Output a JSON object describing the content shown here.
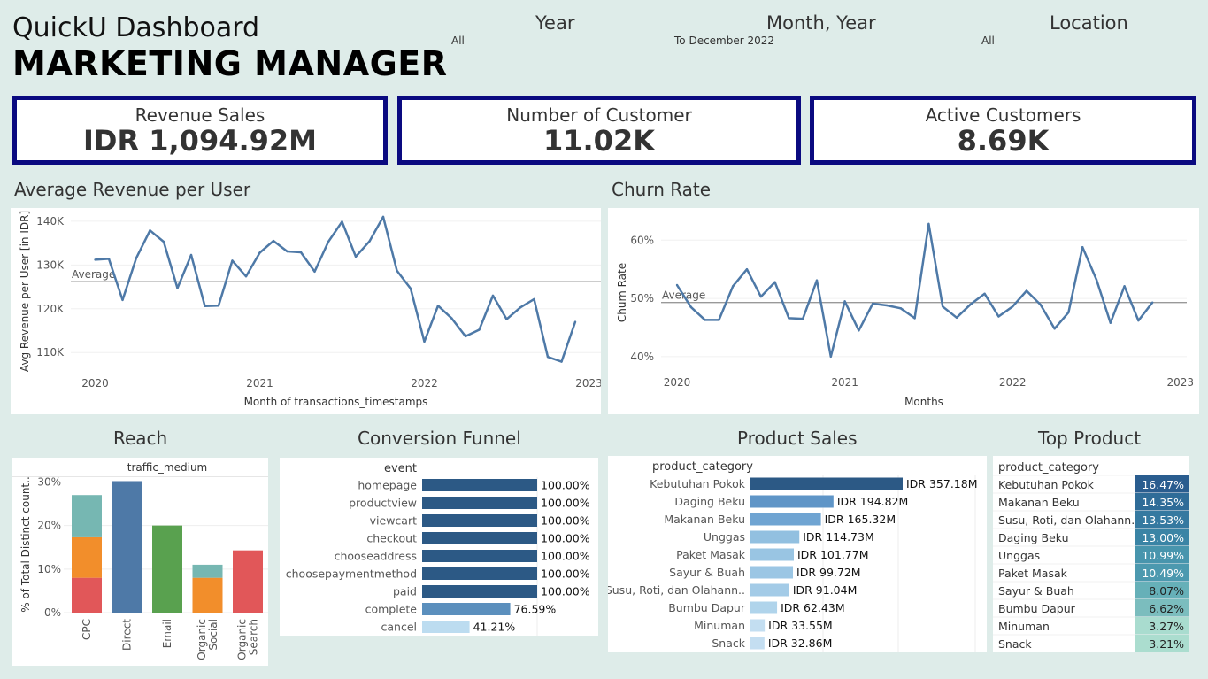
{
  "header": {
    "title": "QuickU Dashboard",
    "subtitle": "MARKETING MANAGER"
  },
  "filters": [
    {
      "label": "Year",
      "value": "All"
    },
    {
      "label": "Month, Year",
      "value": "To December 2022"
    },
    {
      "label": "Location",
      "value": "All"
    }
  ],
  "kpis": [
    {
      "label": "Revenue Sales",
      "value": "IDR 1,094.92M"
    },
    {
      "label": "Number of Customer",
      "value": "11.02K"
    },
    {
      "label": "Active Customers",
      "value": "8.69K"
    }
  ],
  "colors": {
    "line": "#4e79a7",
    "kpi_border": "#0a0a80",
    "background": "#deece9"
  },
  "chart_data": [
    {
      "id": "arpu",
      "type": "line",
      "title": "Average Revenue per User",
      "xlabel": "Month of transactions_timestamps",
      "ylabel": "Avg Revenue per User [in IDR]",
      "x_ticks": [
        "2020",
        "2021",
        "2022",
        "2023"
      ],
      "y_ticks": [
        "110K",
        "120K",
        "130K",
        "140K"
      ],
      "ylim": [
        106,
        142
      ],
      "average_label": "Average",
      "average": 126.2,
      "x": [
        "2020-01",
        "2020-02",
        "2020-03",
        "2020-04",
        "2020-05",
        "2020-06",
        "2020-07",
        "2020-08",
        "2020-09",
        "2020-10",
        "2020-11",
        "2020-12",
        "2021-01",
        "2021-02",
        "2021-03",
        "2021-04",
        "2021-05",
        "2021-06",
        "2021-07",
        "2021-08",
        "2021-09",
        "2021-10",
        "2021-11",
        "2021-12",
        "2022-01",
        "2022-02",
        "2022-03",
        "2022-04",
        "2022-05",
        "2022-06",
        "2022-07",
        "2022-08",
        "2022-09",
        "2022-10",
        "2022-11",
        "2022-12"
      ],
      "values": [
        131.2,
        131.4,
        122,
        131.6,
        137.9,
        135.3,
        124.7,
        132.3,
        120.6,
        120.7,
        131,
        127.4,
        132.8,
        135.5,
        133.1,
        132.9,
        128.5,
        135.3,
        139.9,
        131.9,
        135.4,
        141,
        128.7,
        124.6,
        112.5,
        120.7,
        117.8,
        113.7,
        115.2,
        123,
        117.6,
        120.3,
        122.2,
        109,
        107.9,
        117
      ]
    },
    {
      "id": "churn",
      "type": "line",
      "title": "Churn Rate",
      "xlabel": "Months",
      "ylabel": "Churn Rate",
      "x_ticks": [
        "2020",
        "2021",
        "2022",
        "2023"
      ],
      "y_ticks": [
        "40%",
        "50%",
        "60%"
      ],
      "ylim": [
        38,
        64
      ],
      "average_label": "Average",
      "average": 49.3,
      "x": [
        "2020-01",
        "2020-02",
        "2020-03",
        "2020-04",
        "2020-05",
        "2020-06",
        "2020-07",
        "2020-08",
        "2020-09",
        "2020-10",
        "2020-11",
        "2020-12",
        "2021-01",
        "2021-02",
        "2021-03",
        "2021-04",
        "2021-05",
        "2021-06",
        "2021-07",
        "2021-08",
        "2021-09",
        "2021-10",
        "2021-11",
        "2021-12",
        "2022-01",
        "2022-02",
        "2022-03",
        "2022-04",
        "2022-05",
        "2022-06",
        "2022-07",
        "2022-08",
        "2022-09",
        "2022-10",
        "2022-11",
        "2022-12"
      ],
      "values": [
        52.3,
        48.5,
        46.3,
        46.3,
        52.1,
        55,
        50.3,
        52.8,
        46.6,
        46.5,
        53.1,
        40,
        49.5,
        44.5,
        49.1,
        48.8,
        48.3,
        46.6,
        62.8,
        48.6,
        46.7,
        49,
        50.8,
        46.9,
        48.6,
        51.3,
        48.9,
        44.8,
        47.6,
        58.8,
        53.2,
        45.8,
        52.1,
        46.2,
        49.3,
        null
      ]
    },
    {
      "id": "reach",
      "type": "bar",
      "title": "Reach",
      "header": "traffic_medium",
      "ylabel": "% of Total Distinct count..",
      "y_ticks": [
        "0%",
        "10%",
        "20%",
        "30%"
      ],
      "ylim": [
        0,
        30.5
      ],
      "categories": [
        [
          "CPC"
        ],
        [
          "Direct"
        ],
        [
          "Email"
        ],
        [
          "Organic",
          "Social"
        ],
        [
          "Organic",
          "Search"
        ]
      ],
      "series": [
        {
          "color": "#e15759",
          "values": [
            8,
            0,
            0,
            0,
            14.3
          ]
        },
        {
          "color": "#f28e2b",
          "values": [
            9.3,
            0,
            0,
            8,
            0
          ]
        },
        {
          "color": "#76b7b2",
          "values": [
            9.7,
            0,
            0,
            3,
            0
          ]
        },
        {
          "color": "#4e79a7",
          "values": [
            0,
            30.2,
            0,
            0,
            0
          ]
        },
        {
          "color": "#59a14f",
          "values": [
            0,
            0,
            20,
            0,
            0
          ]
        }
      ]
    },
    {
      "id": "funnel",
      "type": "bar",
      "title": "Conversion Funnel",
      "header": "event",
      "categories": [
        "homepage",
        "productview",
        "viewcart",
        "checkout",
        "chooseaddress",
        "choosepaymentmethod",
        "paid",
        "complete",
        "cancel"
      ],
      "values": [
        100,
        100,
        100,
        100,
        100,
        100,
        100,
        76.59,
        41.21
      ],
      "labels": [
        "100.00%",
        "100.00%",
        "100.00%",
        "100.00%",
        "100.00%",
        "100.00%",
        "100.00%",
        "76.59%",
        "41.21%"
      ],
      "colors": [
        "#2c5985",
        "#2c5985",
        "#2c5985",
        "#2c5985",
        "#2c5985",
        "#2c5985",
        "#2c5985",
        "#5b8fbd",
        "#bcdcf0"
      ]
    },
    {
      "id": "product_sales",
      "type": "bar",
      "title": "Product Sales",
      "header": "product_category",
      "categories": [
        "Kebutuhan Pokok",
        "Daging Beku",
        "Makanan Beku",
        "Unggas",
        "Paket Masak",
        "Sayur & Buah",
        "Susu, Roti, dan Olahann..",
        "Bumbu Dapur",
        "Minuman",
        "Snack"
      ],
      "values": [
        357.18,
        194.82,
        165.32,
        114.73,
        101.77,
        99.72,
        91.04,
        62.43,
        33.55,
        32.86
      ],
      "labels": [
        "IDR 357.18M",
        "IDR 194.82M",
        "IDR 165.32M",
        "IDR 114.73M",
        "IDR 101.77M",
        "IDR 99.72M",
        "IDR 91.04M",
        "IDR 62.43M",
        "IDR 33.55M",
        "IDR 32.86M"
      ],
      "colors": [
        "#2c5985",
        "#5f95c7",
        "#6fa4d2",
        "#92c0e0",
        "#99c5e3",
        "#9bc6e4",
        "#a3cbe7",
        "#b0d4eb",
        "#c3def1",
        "#c4def1"
      ]
    },
    {
      "id": "top_product",
      "type": "table",
      "title": "Top Product",
      "header": "product_category",
      "categories": [
        "Kebutuhan Pokok",
        "Makanan Beku",
        "Susu, Roti, dan Olahann..",
        "Daging Beku",
        "Unggas",
        "Paket Masak",
        "Sayur & Buah",
        "Bumbu Dapur",
        "Minuman",
        "Snack"
      ],
      "values": [
        16.47,
        14.35,
        13.53,
        13.0,
        10.99,
        10.49,
        8.07,
        6.62,
        3.27,
        3.21
      ],
      "labels": [
        "16.47%",
        "14.35%",
        "13.53%",
        "13.00%",
        "10.99%",
        "10.49%",
        "8.07%",
        "6.62%",
        "3.27%",
        "3.21%"
      ],
      "colors": [
        "#2a5d8f",
        "#2f6c98",
        "#3579a0",
        "#3a84a5",
        "#4895ad",
        "#4c99af",
        "#66b0b8",
        "#7bbdbe",
        "#a9dccf",
        "#abddcf"
      ]
    }
  ]
}
